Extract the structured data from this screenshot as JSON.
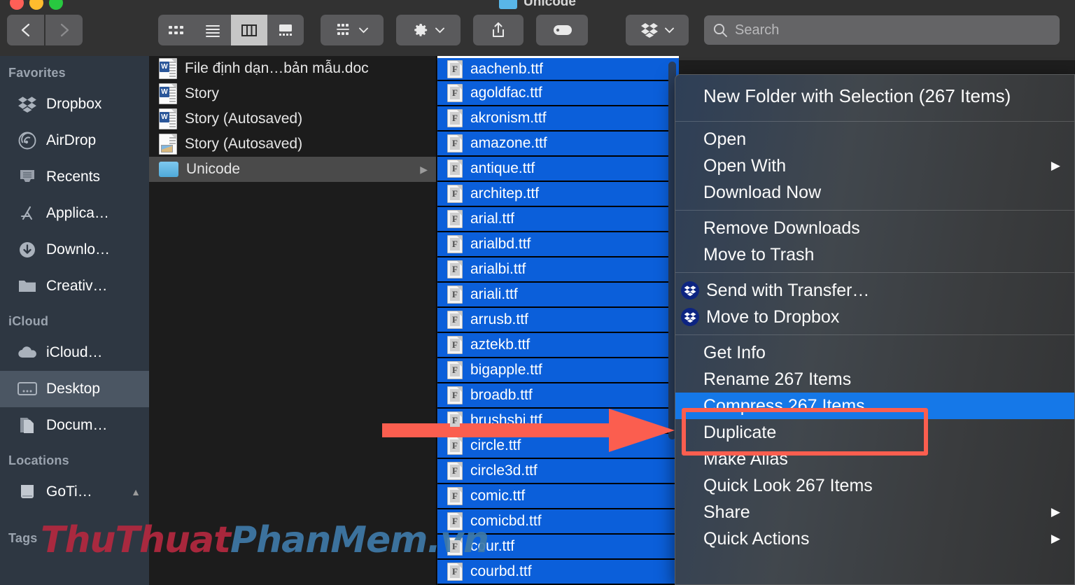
{
  "window": {
    "title": "Unicode",
    "traffic_lights": [
      "close-red",
      "minimize-yellow",
      "zoom-green"
    ]
  },
  "toolbar": {
    "back_label": "‹",
    "forward_label": "›",
    "views": [
      {
        "name": "icon-view",
        "label": "∷",
        "active": false
      },
      {
        "name": "list-view",
        "label": "≡",
        "active": false
      },
      {
        "name": "column-view",
        "label": "‖",
        "active": true
      },
      {
        "name": "gallery-view",
        "label": "▭",
        "active": false
      }
    ],
    "group_by_label": "",
    "action_label": "",
    "share_label": "",
    "tag_label": "",
    "dropbox_label": "",
    "chevron": "∨"
  },
  "search": {
    "placeholder": "Search",
    "value": "",
    "icon": "search-icon"
  },
  "sidebar": {
    "sections": [
      {
        "title": "Favorites",
        "items": [
          {
            "label": "Dropbox",
            "icon": "dropbox-icon",
            "selected": false
          },
          {
            "label": "AirDrop",
            "icon": "airdrop-icon",
            "selected": false
          },
          {
            "label": "Recents",
            "icon": "recents-icon",
            "selected": false
          },
          {
            "label": "Applica…",
            "icon": "applications-icon",
            "selected": false
          },
          {
            "label": "Downlo…",
            "icon": "downloads-icon",
            "selected": false
          },
          {
            "label": "Creativ…",
            "icon": "folder-icon",
            "selected": false
          }
        ]
      },
      {
        "title": "iCloud",
        "items": [
          {
            "label": "iCloud…",
            "icon": "cloud-icon",
            "selected": false
          },
          {
            "label": "Desktop",
            "icon": "desktop-icon",
            "selected": true
          },
          {
            "label": "Docum…",
            "icon": "documents-icon",
            "selected": false
          }
        ]
      },
      {
        "title": "Locations",
        "items": [
          {
            "label": "GoTi…",
            "icon": "drive-icon",
            "selected": false
          }
        ]
      },
      {
        "title": "Tags",
        "items": []
      }
    ]
  },
  "columns": {
    "documents": [
      {
        "label": "File định dạn…bản mẫu.doc",
        "icon": "word-doc-icon",
        "selected": false,
        "disclosure": false
      },
      {
        "label": "Story",
        "icon": "word-doc-icon",
        "selected": false,
        "disclosure": false
      },
      {
        "label": "Story (Autosaved)",
        "icon": "word-doc-icon",
        "selected": false,
        "disclosure": false
      },
      {
        "label": "Story (Autosaved)",
        "icon": "image-doc-icon",
        "selected": false,
        "disclosure": false
      },
      {
        "label": "Unicode",
        "icon": "folder-icon",
        "selected": true,
        "disclosure": true
      }
    ],
    "fonts": [
      {
        "label": "aachenb.ttf",
        "icon": "font-file-icon",
        "selected": true
      },
      {
        "label": "agoldfac.ttf",
        "icon": "font-file-icon",
        "selected": true
      },
      {
        "label": "akronism.ttf",
        "icon": "font-file-icon",
        "selected": true
      },
      {
        "label": "amazone.ttf",
        "icon": "font-file-icon",
        "selected": true
      },
      {
        "label": "antique.ttf",
        "icon": "font-file-icon",
        "selected": true
      },
      {
        "label": "architep.ttf",
        "icon": "font-file-icon",
        "selected": true
      },
      {
        "label": "arial.ttf",
        "icon": "font-file-icon",
        "selected": true
      },
      {
        "label": "arialbd.ttf",
        "icon": "font-file-icon",
        "selected": true
      },
      {
        "label": "arialbi.ttf",
        "icon": "font-file-icon",
        "selected": true
      },
      {
        "label": "ariali.ttf",
        "icon": "font-file-icon",
        "selected": true
      },
      {
        "label": "arrusb.ttf",
        "icon": "font-file-icon",
        "selected": true
      },
      {
        "label": "aztekb.ttf",
        "icon": "font-file-icon",
        "selected": true
      },
      {
        "label": "bigapple.ttf",
        "icon": "font-file-icon",
        "selected": true
      },
      {
        "label": "broadb.ttf",
        "icon": "font-file-icon",
        "selected": true
      },
      {
        "label": "brushsbi.ttf",
        "icon": "font-file-icon",
        "selected": true
      },
      {
        "label": "circle.ttf",
        "icon": "font-file-icon",
        "selected": true
      },
      {
        "label": "circle3d.ttf",
        "icon": "font-file-icon",
        "selected": true
      },
      {
        "label": "comic.ttf",
        "icon": "font-file-icon",
        "selected": true
      },
      {
        "label": "comicbd.ttf",
        "icon": "font-file-icon",
        "selected": true
      },
      {
        "label": "cour.ttf",
        "icon": "font-file-icon",
        "selected": true
      },
      {
        "label": "courbd.ttf",
        "icon": "font-file-icon",
        "selected": true
      }
    ]
  },
  "context_menu": {
    "groups": [
      {
        "items": [
          {
            "label": "New Folder with Selection (267 Items)",
            "submenu": false,
            "icon": null,
            "highlighted": false,
            "big": true
          }
        ]
      },
      {
        "items": [
          {
            "label": "Open",
            "submenu": false,
            "icon": null,
            "highlighted": false
          },
          {
            "label": "Open With",
            "submenu": true,
            "icon": null,
            "highlighted": false
          },
          {
            "label": "Download Now",
            "submenu": false,
            "icon": null,
            "highlighted": false
          }
        ]
      },
      {
        "items": [
          {
            "label": "Remove Downloads",
            "submenu": false,
            "icon": null,
            "highlighted": false
          },
          {
            "label": "Move to Trash",
            "submenu": false,
            "icon": null,
            "highlighted": false
          }
        ]
      },
      {
        "items": [
          {
            "label": "Send with Transfer…",
            "submenu": false,
            "icon": "dropbox-icon",
            "highlighted": false
          },
          {
            "label": "Move to Dropbox",
            "submenu": false,
            "icon": "dropbox-icon",
            "highlighted": false
          }
        ]
      },
      {
        "items": [
          {
            "label": "Get Info",
            "submenu": false,
            "icon": null,
            "highlighted": false
          },
          {
            "label": "Rename 267 Items",
            "submenu": false,
            "icon": null,
            "highlighted": false
          },
          {
            "label": "Compress 267 Items",
            "submenu": false,
            "icon": null,
            "highlighted": true
          },
          {
            "label": "Duplicate",
            "submenu": false,
            "icon": null,
            "highlighted": false
          },
          {
            "label": "Make Alias",
            "submenu": false,
            "icon": null,
            "highlighted": false
          },
          {
            "label": "Quick Look 267 Items",
            "submenu": false,
            "icon": null,
            "highlighted": false
          },
          {
            "label": "Share",
            "submenu": true,
            "icon": null,
            "highlighted": false
          },
          {
            "label": "Quick Actions",
            "submenu": true,
            "icon": null,
            "highlighted": false
          }
        ]
      }
    ]
  },
  "annotations": {
    "arrow": {
      "name": "callout-arrow",
      "color": "#fb5e4f"
    },
    "box": {
      "name": "callout-box",
      "color": "#fb5e4f"
    }
  },
  "watermark": {
    "part1": "ThuThuat",
    "part2": "PhanMem.vn",
    "color1": "#b4283f",
    "color2": "#3f7aa8"
  },
  "colors": {
    "selection_blue": "#0b5fda",
    "menu_highlight": "#1578e8",
    "accent_red": "#fb5e4f",
    "sidebar_bg": "#2e3742",
    "toolbar_bg": "#323232"
  }
}
